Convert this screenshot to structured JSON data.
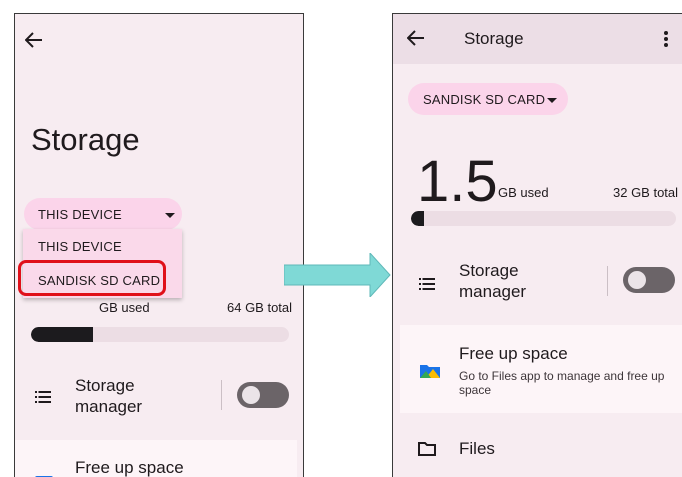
{
  "left_screen": {
    "title": "Storage",
    "volume_selector": {
      "selected": "THIS DEVICE"
    },
    "dropdown": {
      "options": [
        "THIS DEVICE",
        "SANDISK SD CARD"
      ],
      "highlighted": "SANDISK SD CARD"
    },
    "usage": {
      "used_label": "GB used",
      "total": "64 GB total",
      "fill_fraction": 0.24
    },
    "storage_manager": {
      "label": "Storage manager",
      "enabled": false
    },
    "free_up_space": {
      "title": "Free up space"
    }
  },
  "right_screen": {
    "app_bar": {
      "title": "Storage"
    },
    "volume_selector": {
      "selected": "SANDISK SD CARD"
    },
    "usage": {
      "used_value": "1.5",
      "used_label": "GB used",
      "total": "32 GB total",
      "fill_fraction": 0.05
    },
    "storage_manager": {
      "label": "Storage manager",
      "enabled": false
    },
    "free_up_space": {
      "title": "Free up space",
      "subtitle": "Go to Files app to manage and free up space"
    },
    "files": {
      "label": "Files"
    }
  },
  "colors": {
    "screen_bg": "#f7ecf1",
    "chip_bg": "#fbd4ea",
    "highlight_border": "#e0101a",
    "arrow_fill": "#7fd9d6",
    "toggle_off": "#6b6468"
  },
  "icons": {
    "back": "arrow-left-icon",
    "more": "more-vert-icon",
    "storage_manager": "list-icon",
    "free_up_space": "files-app-icon",
    "files": "folder-icon",
    "dropdown": "caret-down-icon"
  }
}
